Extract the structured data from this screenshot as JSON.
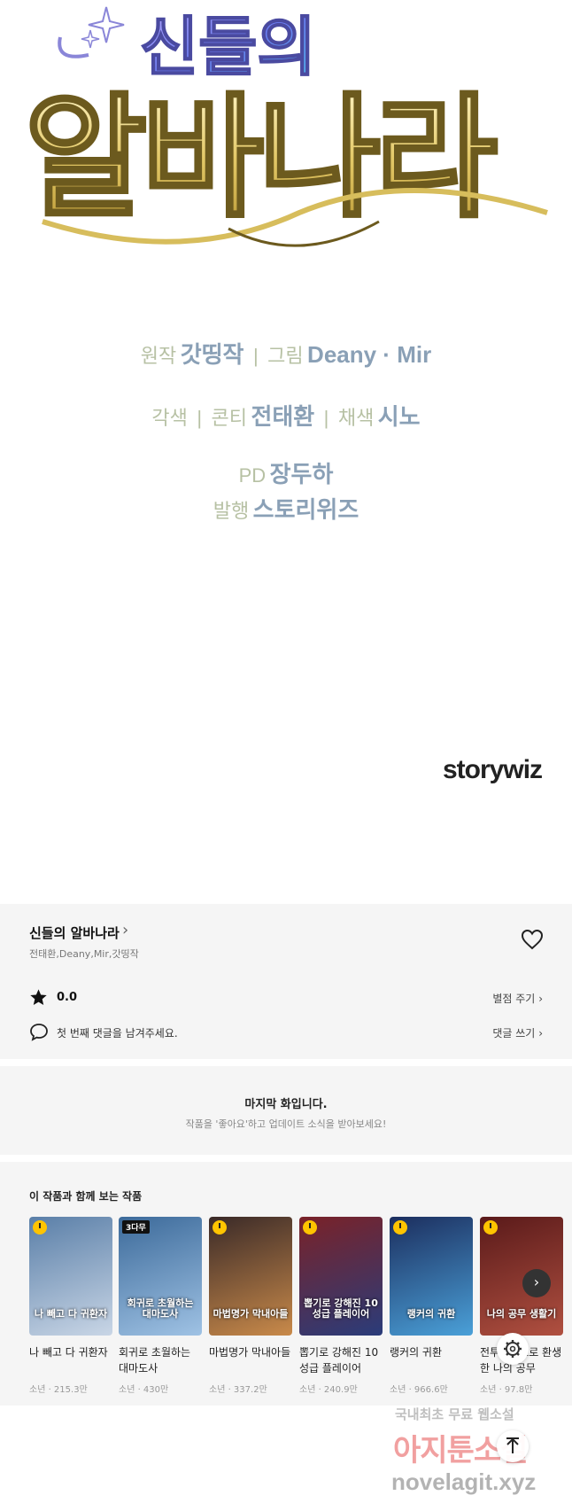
{
  "comic": {
    "logo_title": "신들의 알바나라",
    "credits_line1": {
      "original_label": "원작",
      "original_name": "갓띵작",
      "sep": "|",
      "art_label": "그림",
      "art_name": "Deany · Mir"
    },
    "credits_line2": {
      "adapt_label": "각색",
      "sep1": "|",
      "conti_label": "콘티",
      "conti_name": "전태환",
      "sep2": "|",
      "color_label": "채색",
      "color_name": "시노"
    },
    "credits_line3": {
      "pd_label": "PD",
      "pd_name": "장두하"
    },
    "credits_line4": {
      "pub_label": "발행",
      "pub_name": "스토리위즈"
    },
    "brand": "storywiz"
  },
  "info": {
    "series_title": "신들의 알바나라",
    "authors": "전태환,Deany,Mir,갓띵작",
    "rating": "0.0",
    "rate_button": "별점 주기",
    "comment_prompt": "첫 번째 댓글을 남겨주세요.",
    "comment_button": "댓글 쓰기"
  },
  "last_episode": {
    "title": "마지막 화입니다.",
    "subtitle": "작품을 '좋아요'하고 업데이트 소식을 받아보세요!"
  },
  "recommendations": {
    "heading": "이 작품과 함께 보는 작품",
    "items": [
      {
        "title": "나 빼고 다 귀환자",
        "meta": "소년 · 215.3만",
        "cover_text": "나 빼고 다 귀환자",
        "badge": "clock",
        "colors": [
          "#5a7fa8",
          "#c9d6e6"
        ]
      },
      {
        "title": "회귀로 초월하는 대마도사",
        "meta": "소년 · 430만",
        "cover_text": "회귀로 초월하는 대마도사",
        "badge": "3다무",
        "colors": [
          "#3c6a9a",
          "#9fc2e4"
        ]
      },
      {
        "title": "마법명가 막내아들",
        "meta": "소년 · 337.2만",
        "cover_text": "마법명가 막내아들",
        "badge": "clock",
        "colors": [
          "#3a2a28",
          "#c98a4a"
        ]
      },
      {
        "title": "뽑기로 강해진 10성급 플레이어",
        "meta": "소년 · 240.9만",
        "cover_text": "뽑기로 강해진 10성급 플레이어",
        "badge": "clock",
        "colors": [
          "#7a2228",
          "#2a3c7a"
        ]
      },
      {
        "title": "랭커의 귀환",
        "meta": "소년 · 966.6만",
        "cover_text": "랭커의 귀환",
        "badge": "clock",
        "colors": [
          "#1c2e5e",
          "#4aa0d8"
        ]
      },
      {
        "title": "전투종족으로 환생한 나의 공무",
        "meta": "소년 · 97.8만",
        "cover_text": "나의 공무 생활기",
        "badge": "clock",
        "colors": [
          "#5a1a1a",
          "#b05040"
        ]
      }
    ]
  },
  "watermark": {
    "line1": "국내최초 무료 웹소설",
    "line2": "아지툰소설",
    "line3": "novelagit.xyz"
  },
  "colors": {
    "panel_bg": "#f5f5f5",
    "credit_label": "#b7c1a4",
    "credit_name": "#8aa0b6",
    "badge_yellow": "#ffc400"
  }
}
